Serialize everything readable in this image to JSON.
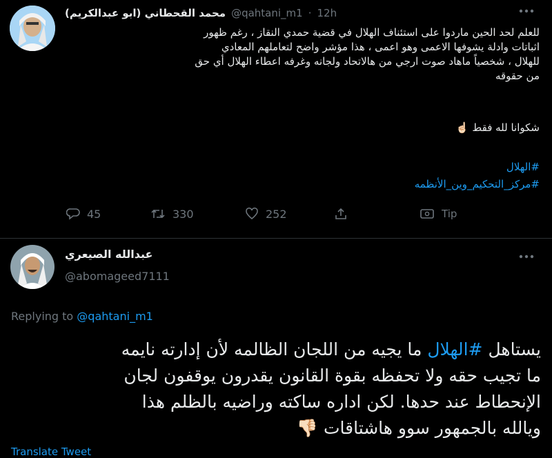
{
  "quoted_tweet": {
    "author_name": "محمد القحطاني (ابو عبدالكريم)",
    "handle": "@qahtani_m1",
    "separator": "·",
    "time": "12h",
    "lines": [
      "للعلم لحد الحين ماردوا على استئناف الهلال في قضية حمدي النقاز ، رغم ظهور",
      "اثباتات وادلة يشوفها الاعمى وهو اعمى ، هذا مؤشر واضح لتعاملهم المعادي",
      "للهلال ، شخصياً ماهاد صوت ارجي من هالاتحاد ولجانه وغرفه اعطاء الهلال أي حق",
      "من حقوقه"
    ],
    "closing_line": "شكوانا لله فقط",
    "closing_emoji": "☝🏻",
    "hashtags": [
      "#الهلال",
      "#مركز_التحكيم_وين_الأنظمه"
    ],
    "actions": {
      "reply_count": "45",
      "retweet_count": "330",
      "like_count": "252",
      "tip_label": "Tip"
    }
  },
  "main_tweet": {
    "author_name": "عبدالله الصيعري",
    "handle": "@abomageed7111",
    "replying_to_prefix": "Replying to",
    "replying_to_handle": "@qahtani_m1",
    "text_lines": {
      "line1_before": "يستاهل ",
      "line1_hashtag": "#الهلال",
      "line1_after": " ما يجيه من اللجان الظالمه لأن إدارته نايمه",
      "line2": "ما تجيب حقه ولا تحفظه بقوة القانون يقدرون يوقفون لجان",
      "line3": "الإنحطاط عند حدها. لكن اداره ساكته وراضيه بالظلم هذا",
      "line4": "ويالله بالجمهور سوو هاشتاقات",
      "line4_emoji": "👎🏻"
    },
    "translate_label": "Translate Tweet"
  },
  "colors": {
    "background": "#000000",
    "text": "#e7e9ea",
    "muted": "#6e767d",
    "accent": "#1d9bf0"
  }
}
